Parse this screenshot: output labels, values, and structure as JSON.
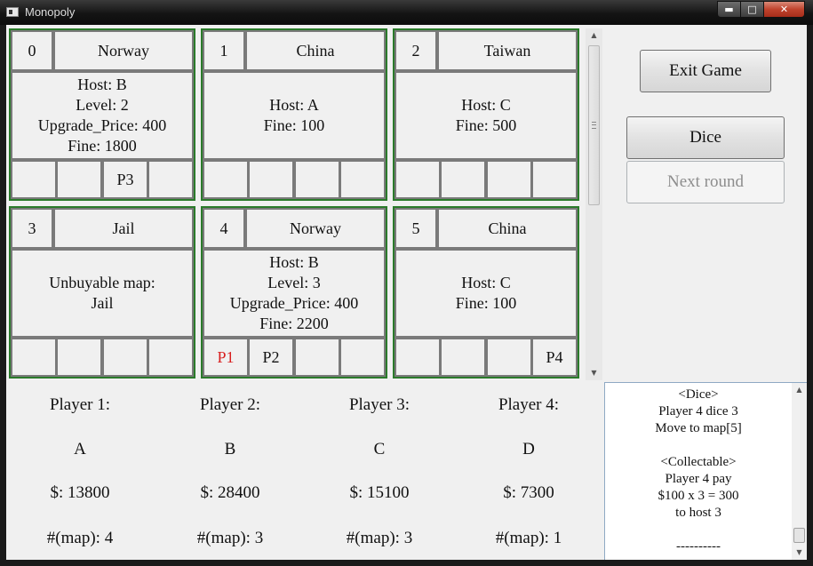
{
  "window": {
    "title": "Monopoly",
    "minimize_glyph": "▬",
    "maximize_glyph": "□",
    "close_glyph": "✕"
  },
  "board": {
    "tiles": [
      {
        "index": "0",
        "name": "Norway",
        "info": [
          "Host: B",
          "Level: 2",
          "Upgrade_Price: 400",
          "Fine: 1800"
        ],
        "slots": [
          "",
          "",
          "P3",
          ""
        ]
      },
      {
        "index": "1",
        "name": "China",
        "info": [
          "Host: A",
          "Fine: 100"
        ],
        "slots": [
          "",
          "",
          "",
          ""
        ]
      },
      {
        "index": "2",
        "name": "Taiwan",
        "info": [
          "Host: C",
          "Fine: 500"
        ],
        "slots": [
          "",
          "",
          "",
          ""
        ]
      },
      {
        "index": "3",
        "name": "Jail",
        "info": [
          "Unbuyable map:",
          "Jail"
        ],
        "slots": [
          "",
          "",
          "",
          ""
        ]
      },
      {
        "index": "4",
        "name": "Norway",
        "info": [
          "Host: B",
          "Level: 3",
          "Upgrade_Price: 400",
          "Fine: 2200"
        ],
        "slots": [
          "P1",
          "P2",
          "",
          ""
        ]
      },
      {
        "index": "5",
        "name": "China",
        "info": [
          "Host: C",
          "Fine: 100"
        ],
        "slots": [
          "",
          "",
          "",
          "P4"
        ]
      }
    ]
  },
  "controls": {
    "exit_label": "Exit Game",
    "dice_label": "Dice",
    "next_round_label": "Next round"
  },
  "players": [
    {
      "label": "Player 1:",
      "name": "A",
      "money": "$: 13800",
      "maps": "#(map): 4"
    },
    {
      "label": "Player 2:",
      "name": "B",
      "money": "$: 28400",
      "maps": "#(map): 3"
    },
    {
      "label": "Player 3:",
      "name": "C",
      "money": "$: 15100",
      "maps": "#(map): 3"
    },
    {
      "label": "Player 4:",
      "name": "D",
      "money": "$: 7300",
      "maps": "#(map): 1"
    }
  ],
  "log": {
    "lines": [
      "<Dice>",
      "Player 4 dice 3",
      "Move to map[5]",
      "",
      "<Collectable>",
      "Player 4 pay",
      "$100 x 3 = 300",
      "to host 3",
      "",
      "----------"
    ]
  },
  "colors": {
    "tile_border": "#2a7a2a",
    "current_player": "#d81e1e"
  },
  "current_player": "P1"
}
